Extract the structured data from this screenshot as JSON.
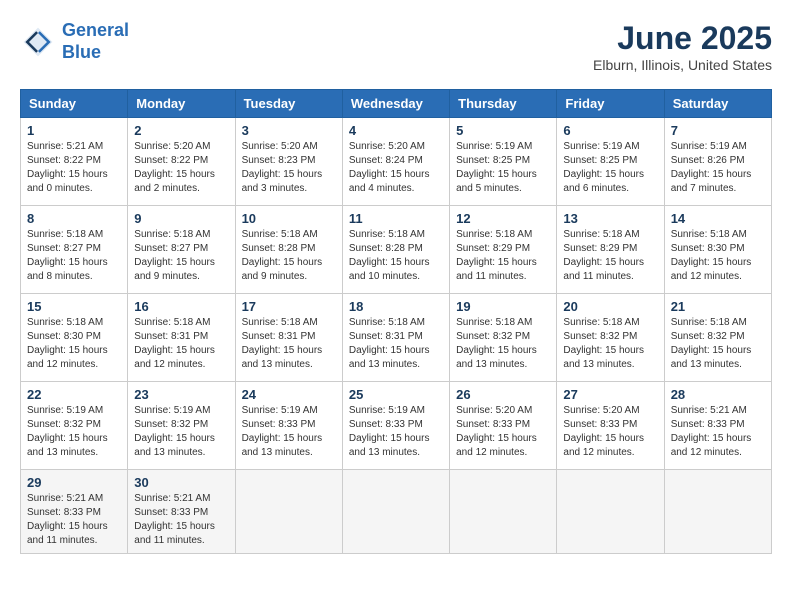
{
  "logo": {
    "line1": "General",
    "line2": "Blue"
  },
  "title": "June 2025",
  "subtitle": "Elburn, Illinois, United States",
  "headers": [
    "Sunday",
    "Monday",
    "Tuesday",
    "Wednesday",
    "Thursday",
    "Friday",
    "Saturday"
  ],
  "weeks": [
    [
      {
        "day": "1",
        "lines": [
          "Sunrise: 5:21 AM",
          "Sunset: 8:22 PM",
          "Daylight: 15 hours",
          "and 0 minutes."
        ]
      },
      {
        "day": "2",
        "lines": [
          "Sunrise: 5:20 AM",
          "Sunset: 8:22 PM",
          "Daylight: 15 hours",
          "and 2 minutes."
        ]
      },
      {
        "day": "3",
        "lines": [
          "Sunrise: 5:20 AM",
          "Sunset: 8:23 PM",
          "Daylight: 15 hours",
          "and 3 minutes."
        ]
      },
      {
        "day": "4",
        "lines": [
          "Sunrise: 5:20 AM",
          "Sunset: 8:24 PM",
          "Daylight: 15 hours",
          "and 4 minutes."
        ]
      },
      {
        "day": "5",
        "lines": [
          "Sunrise: 5:19 AM",
          "Sunset: 8:25 PM",
          "Daylight: 15 hours",
          "and 5 minutes."
        ]
      },
      {
        "day": "6",
        "lines": [
          "Sunrise: 5:19 AM",
          "Sunset: 8:25 PM",
          "Daylight: 15 hours",
          "and 6 minutes."
        ]
      },
      {
        "day": "7",
        "lines": [
          "Sunrise: 5:19 AM",
          "Sunset: 8:26 PM",
          "Daylight: 15 hours",
          "and 7 minutes."
        ]
      }
    ],
    [
      {
        "day": "8",
        "lines": [
          "Sunrise: 5:18 AM",
          "Sunset: 8:27 PM",
          "Daylight: 15 hours",
          "and 8 minutes."
        ]
      },
      {
        "day": "9",
        "lines": [
          "Sunrise: 5:18 AM",
          "Sunset: 8:27 PM",
          "Daylight: 15 hours",
          "and 9 minutes."
        ]
      },
      {
        "day": "10",
        "lines": [
          "Sunrise: 5:18 AM",
          "Sunset: 8:28 PM",
          "Daylight: 15 hours",
          "and 9 minutes."
        ]
      },
      {
        "day": "11",
        "lines": [
          "Sunrise: 5:18 AM",
          "Sunset: 8:28 PM",
          "Daylight: 15 hours",
          "and 10 minutes."
        ]
      },
      {
        "day": "12",
        "lines": [
          "Sunrise: 5:18 AM",
          "Sunset: 8:29 PM",
          "Daylight: 15 hours",
          "and 11 minutes."
        ]
      },
      {
        "day": "13",
        "lines": [
          "Sunrise: 5:18 AM",
          "Sunset: 8:29 PM",
          "Daylight: 15 hours",
          "and 11 minutes."
        ]
      },
      {
        "day": "14",
        "lines": [
          "Sunrise: 5:18 AM",
          "Sunset: 8:30 PM",
          "Daylight: 15 hours",
          "and 12 minutes."
        ]
      }
    ],
    [
      {
        "day": "15",
        "lines": [
          "Sunrise: 5:18 AM",
          "Sunset: 8:30 PM",
          "Daylight: 15 hours",
          "and 12 minutes."
        ]
      },
      {
        "day": "16",
        "lines": [
          "Sunrise: 5:18 AM",
          "Sunset: 8:31 PM",
          "Daylight: 15 hours",
          "and 12 minutes."
        ]
      },
      {
        "day": "17",
        "lines": [
          "Sunrise: 5:18 AM",
          "Sunset: 8:31 PM",
          "Daylight: 15 hours",
          "and 13 minutes."
        ]
      },
      {
        "day": "18",
        "lines": [
          "Sunrise: 5:18 AM",
          "Sunset: 8:31 PM",
          "Daylight: 15 hours",
          "and 13 minutes."
        ]
      },
      {
        "day": "19",
        "lines": [
          "Sunrise: 5:18 AM",
          "Sunset: 8:32 PM",
          "Daylight: 15 hours",
          "and 13 minutes."
        ]
      },
      {
        "day": "20",
        "lines": [
          "Sunrise: 5:18 AM",
          "Sunset: 8:32 PM",
          "Daylight: 15 hours",
          "and 13 minutes."
        ]
      },
      {
        "day": "21",
        "lines": [
          "Sunrise: 5:18 AM",
          "Sunset: 8:32 PM",
          "Daylight: 15 hours",
          "and 13 minutes."
        ]
      }
    ],
    [
      {
        "day": "22",
        "lines": [
          "Sunrise: 5:19 AM",
          "Sunset: 8:32 PM",
          "Daylight: 15 hours",
          "and 13 minutes."
        ]
      },
      {
        "day": "23",
        "lines": [
          "Sunrise: 5:19 AM",
          "Sunset: 8:32 PM",
          "Daylight: 15 hours",
          "and 13 minutes."
        ]
      },
      {
        "day": "24",
        "lines": [
          "Sunrise: 5:19 AM",
          "Sunset: 8:33 PM",
          "Daylight: 15 hours",
          "and 13 minutes."
        ]
      },
      {
        "day": "25",
        "lines": [
          "Sunrise: 5:19 AM",
          "Sunset: 8:33 PM",
          "Daylight: 15 hours",
          "and 13 minutes."
        ]
      },
      {
        "day": "26",
        "lines": [
          "Sunrise: 5:20 AM",
          "Sunset: 8:33 PM",
          "Daylight: 15 hours",
          "and 12 minutes."
        ]
      },
      {
        "day": "27",
        "lines": [
          "Sunrise: 5:20 AM",
          "Sunset: 8:33 PM",
          "Daylight: 15 hours",
          "and 12 minutes."
        ]
      },
      {
        "day": "28",
        "lines": [
          "Sunrise: 5:21 AM",
          "Sunset: 8:33 PM",
          "Daylight: 15 hours",
          "and 12 minutes."
        ]
      }
    ],
    [
      {
        "day": "29",
        "lines": [
          "Sunrise: 5:21 AM",
          "Sunset: 8:33 PM",
          "Daylight: 15 hours",
          "and 11 minutes."
        ]
      },
      {
        "day": "30",
        "lines": [
          "Sunrise: 5:21 AM",
          "Sunset: 8:33 PM",
          "Daylight: 15 hours",
          "and 11 minutes."
        ]
      },
      null,
      null,
      null,
      null,
      null
    ]
  ]
}
